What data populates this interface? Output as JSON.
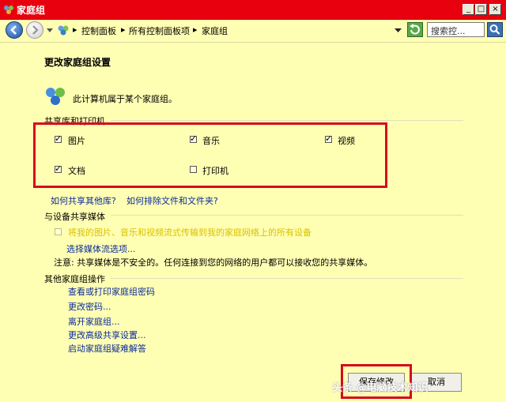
{
  "window": {
    "title": "家庭组",
    "buttons": {
      "minimize": "_",
      "maximize": "□",
      "close": "×"
    }
  },
  "nav": {
    "breadcrumbs": [
      "控制面板",
      "所有控制面板项",
      "家庭组"
    ],
    "search_placeholder": "搜索控..."
  },
  "page": {
    "title": "更改家庭组设置",
    "membership_text": "此计算机属于某个家庭组。",
    "share_section_label": "共享库和打印机",
    "share_items": [
      {
        "label": "图片",
        "checked": true
      },
      {
        "label": "音乐",
        "checked": true
      },
      {
        "label": "视频",
        "checked": true
      },
      {
        "label": "文档",
        "checked": true
      },
      {
        "label": "打印机",
        "checked": false
      }
    ],
    "link_share_libs": "如何共享其他库?",
    "link_exclude": "如何排除文件和文件夹?",
    "media_section_label": "与设备共享媒体",
    "media_checkbox_label": "将我的图片、音乐和视频流式传输到我的家庭网络上的所有设备",
    "choose_media_link": "选择媒体流选项...",
    "note_text": "注意: 共享媒体是不安全的。任何连接到您的网络的用户都可以接收您的共享媒体。",
    "other_section_label": "其他家庭组操作",
    "other_actions": [
      "查看或打印家庭组密码",
      "更改密码...",
      "离开家庭组...",
      "更改高级共享设置...",
      "启动家庭组疑难解答"
    ]
  },
  "footer": {
    "save_label": "保存修改",
    "cancel_label": "取消",
    "watermark": "头条 @电脑技术知识"
  },
  "colors": {
    "background": "#ffffb4",
    "titlebar": "#e8000e",
    "highlight_box": "#d40a1e",
    "link": "#0a2a9a"
  }
}
